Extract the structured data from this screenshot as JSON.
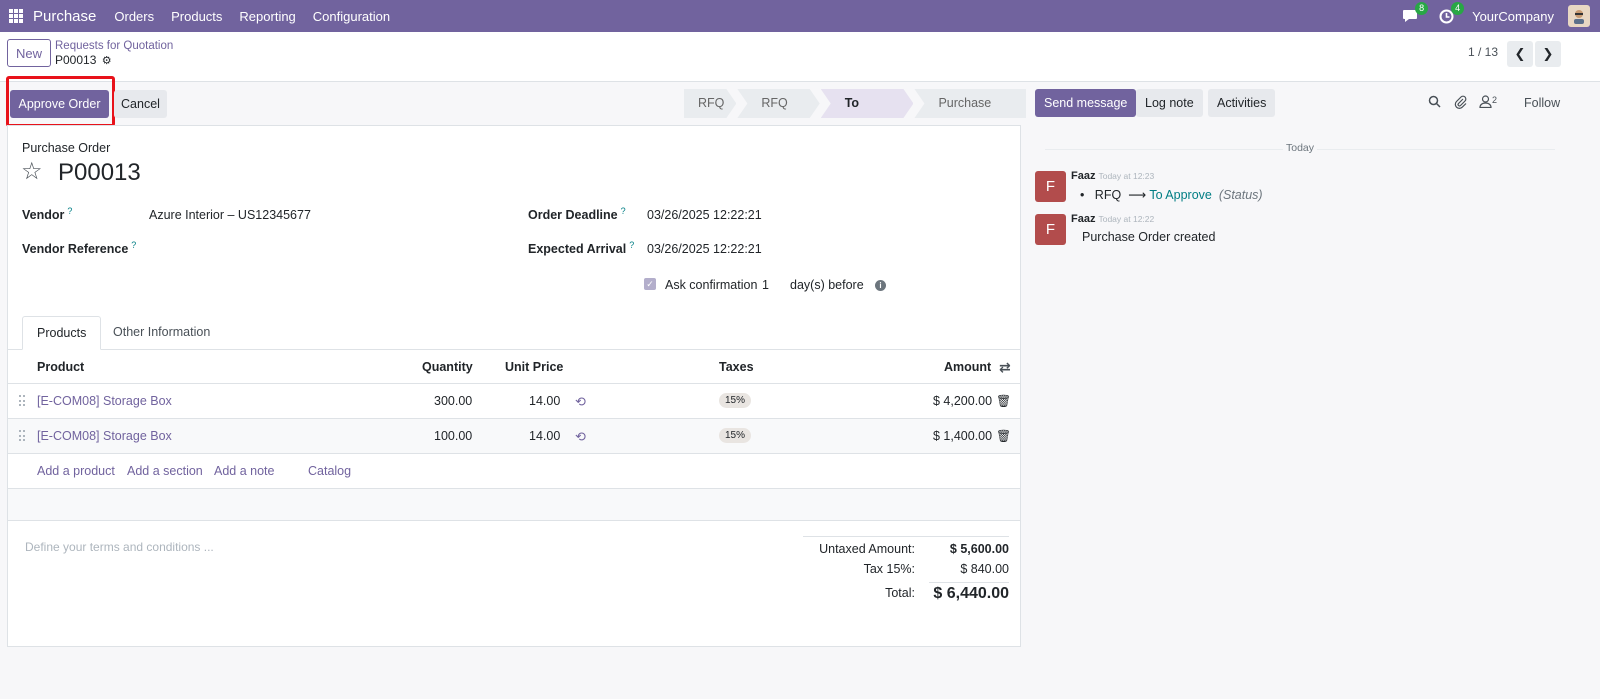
{
  "navbar": {
    "app_name": "Purchase",
    "menu": [
      "Orders",
      "Products",
      "Reporting",
      "Configuration"
    ],
    "messages_count": "8",
    "activities_count": "4",
    "company": "YourCompany"
  },
  "control_panel": {
    "new_label": "New",
    "breadcrumb": "Requests for Quotation",
    "record": "P00013",
    "pager": "1 / 13"
  },
  "statusbar": {
    "approve_label": "Approve Order",
    "cancel_label": "Cancel",
    "stages": [
      {
        "label": "RFQ",
        "active": false
      },
      {
        "label": "RFQ Sent",
        "active": false
      },
      {
        "label": "To Approve",
        "active": true
      },
      {
        "label": "Purchase Order",
        "active": false
      }
    ]
  },
  "form": {
    "type_label": "Purchase Order",
    "title": "P00013",
    "vendor_label": "Vendor",
    "vendor_value": "Azure Interior – US12345677",
    "vendor_ref_label": "Vendor Reference",
    "order_deadline_label": "Order Deadline",
    "order_deadline_value": "03/26/2025 12:22:21",
    "expected_arrival_label": "Expected Arrival",
    "expected_arrival_value": "03/26/2025 12:22:21",
    "ask_confirmation_label": "Ask confirmation",
    "ask_confirmation_days": "1",
    "days_before_label": "day(s) before",
    "help_mark": "?"
  },
  "tabs": {
    "products": "Products",
    "other": "Other Information"
  },
  "table": {
    "headers": {
      "product": "Product",
      "quantity": "Quantity",
      "unit_price": "Unit Price",
      "taxes": "Taxes",
      "amount": "Amount"
    },
    "rows": [
      {
        "product": "[E-COM08] Storage Box",
        "quantity": "300.00",
        "unit_price": "14.00",
        "tax": "15%",
        "amount": "$ 4,200.00"
      },
      {
        "product": "[E-COM08] Storage Box",
        "quantity": "100.00",
        "unit_price": "14.00",
        "tax": "15%",
        "amount": "$ 1,400.00"
      }
    ],
    "add_product": "Add a product",
    "add_section": "Add a section",
    "add_note": "Add a note",
    "catalog": "Catalog"
  },
  "terms_placeholder": "Define your terms and conditions ...",
  "totals": {
    "untaxed_label": "Untaxed Amount:",
    "untaxed_value": "$ 5,600.00",
    "tax_label": "Tax 15%:",
    "tax_value": "$ 840.00",
    "total_label": "Total:",
    "total_value": "$ 6,440.00"
  },
  "chatter": {
    "send_message": "Send message",
    "log_note": "Log note",
    "activities": "Activities",
    "followers_count": "2",
    "follow": "Follow",
    "today": "Today",
    "messages": [
      {
        "avatar": "F",
        "author": "Faaz",
        "time": "Today at 12:23",
        "from": "RFQ",
        "arrow": "⟶",
        "to": "To Approve",
        "field": "(Status)"
      },
      {
        "avatar": "F",
        "author": "Faaz",
        "time": "Today at 12:22",
        "body": "Purchase Order created"
      }
    ]
  },
  "colors": {
    "brand": "#71639e",
    "highlight": "#e8121a",
    "link_teal": "#017e84"
  },
  "icons": [
    "apps-grid-icon",
    "chat-icon",
    "clock-icon",
    "gear-icon",
    "chevron-left-icon",
    "chevron-right-icon",
    "star-icon",
    "info-icon",
    "drag-handle-icon",
    "reset-icon",
    "trash-icon",
    "adjust-columns-icon",
    "search-icon",
    "paperclip-icon",
    "user-icon"
  ]
}
